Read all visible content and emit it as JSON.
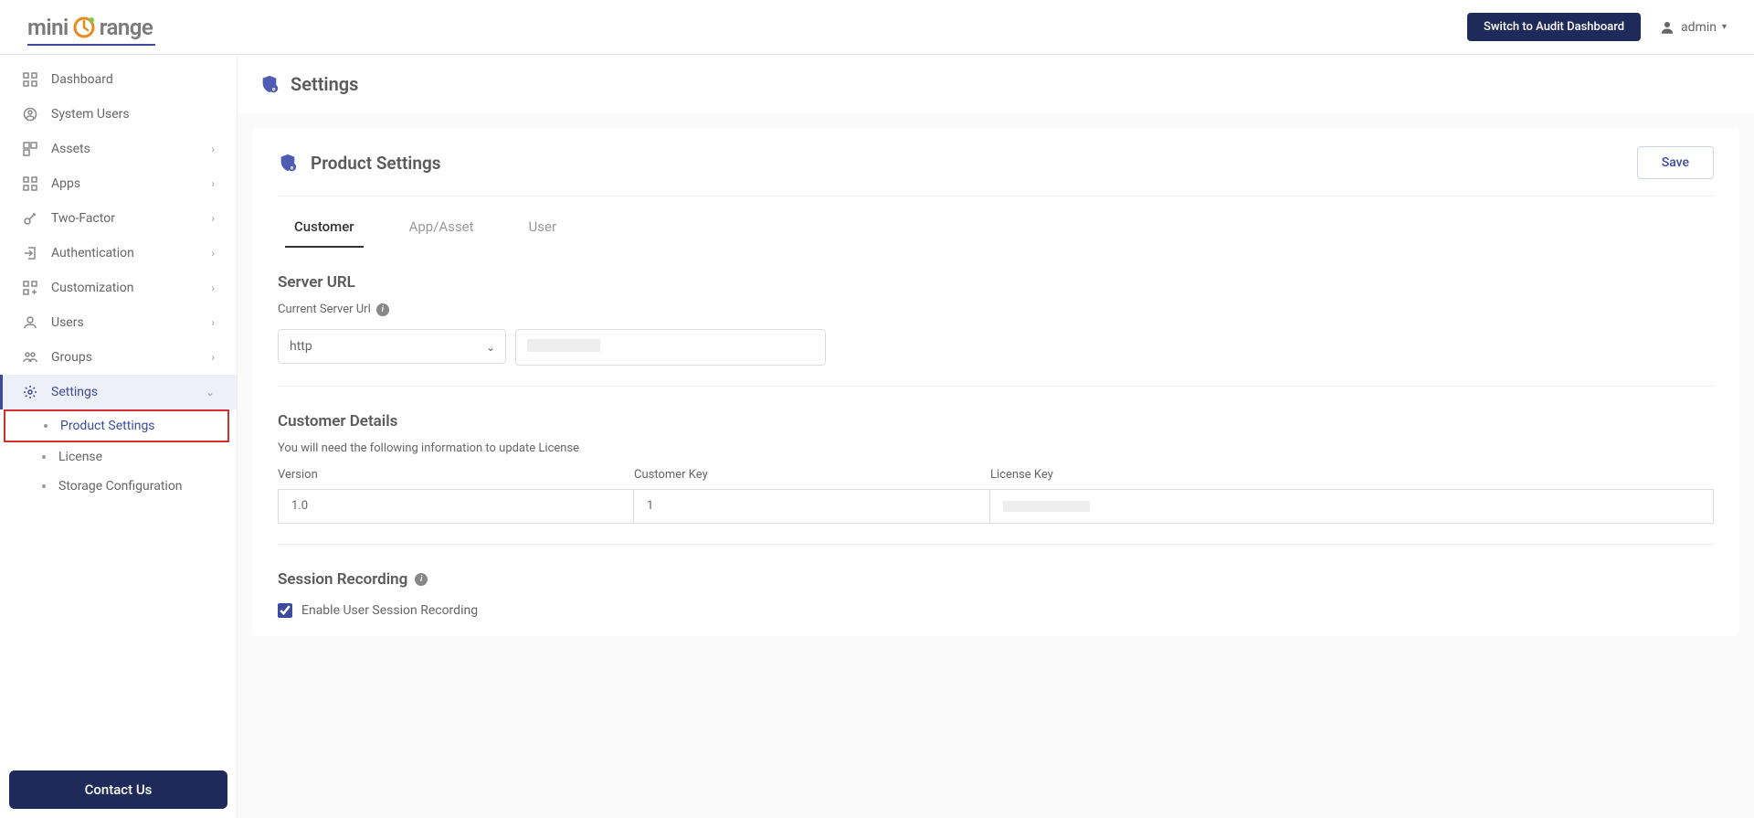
{
  "header": {
    "logo_prefix": "mini",
    "logo_suffix": "range",
    "audit_button": "Switch to Audit Dashboard",
    "username": "admin"
  },
  "sidebar": {
    "items": [
      {
        "label": "Dashboard"
      },
      {
        "label": "System Users"
      },
      {
        "label": "Assets"
      },
      {
        "label": "Apps"
      },
      {
        "label": "Two-Factor"
      },
      {
        "label": "Authentication"
      },
      {
        "label": "Customization"
      },
      {
        "label": "Users"
      },
      {
        "label": "Groups"
      },
      {
        "label": "Settings"
      }
    ],
    "settings_sub": [
      {
        "label": "Product Settings"
      },
      {
        "label": "License"
      },
      {
        "label": "Storage Configuration"
      }
    ],
    "contact": "Contact Us"
  },
  "page": {
    "title": "Settings",
    "card_title": "Product Settings",
    "save_button": "Save",
    "tabs": [
      "Customer",
      "App/Asset",
      "User"
    ],
    "server_url": {
      "heading": "Server URL",
      "label": "Current Server Url",
      "protocol": "http"
    },
    "customer_details": {
      "heading": "Customer Details",
      "subtext": "You will need the following information to update License",
      "columns": {
        "version": {
          "label": "Version",
          "value": "1.0"
        },
        "customer_key": {
          "label": "Customer Key",
          "value": "1"
        },
        "license_key": {
          "label": "License Key",
          "value": ""
        }
      }
    },
    "session_recording": {
      "heading": "Session Recording",
      "checkbox_label": "Enable User Session Recording",
      "checked": true
    }
  }
}
